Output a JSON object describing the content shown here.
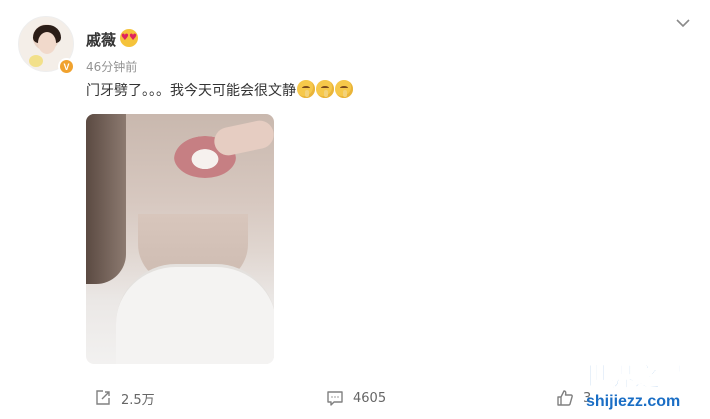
{
  "post": {
    "username": "戚薇",
    "verified_badge": "V",
    "timestamp": "46分钟前",
    "text": "门牙劈了。。。我今天可能会很文静",
    "emoji_count": 3,
    "username_emoji": "heart-eyes-emoji",
    "text_emoji": "shushing-face-emoji"
  },
  "actions": {
    "repost_count": "2.5万",
    "comment_count": "4605",
    "like_count": "3"
  },
  "watermark": {
    "title": "世界之最",
    "url": "shijiezz.com"
  },
  "colors": {
    "text": "#333333",
    "muted": "#939393",
    "badge": "#f0a22e",
    "watermark": "#1a6ec5"
  }
}
